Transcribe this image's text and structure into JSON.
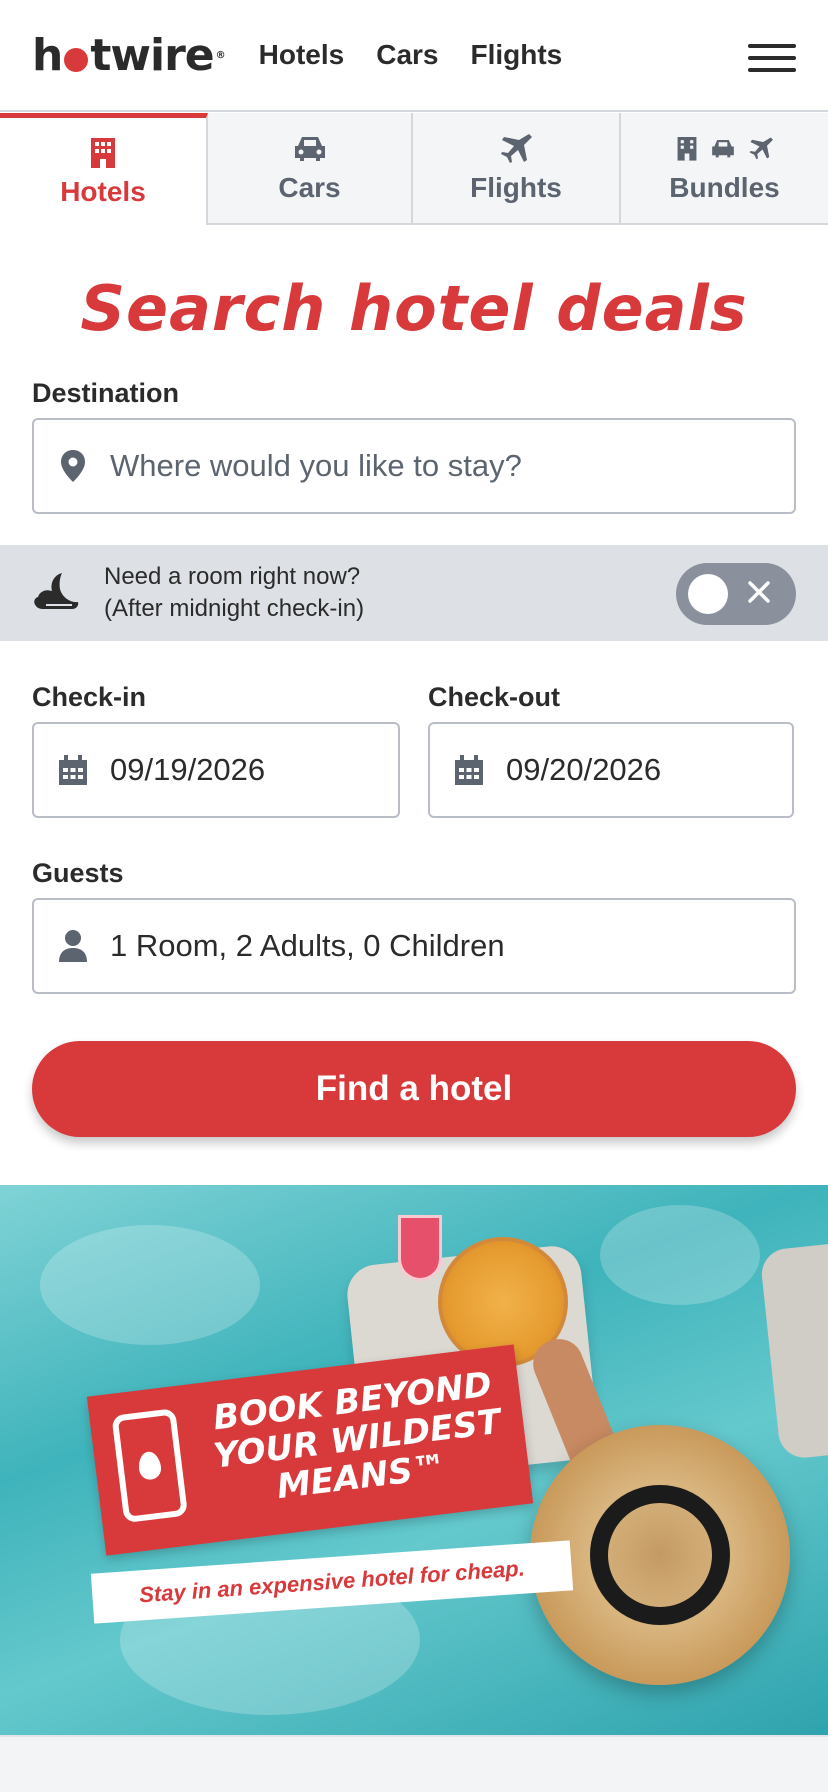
{
  "header": {
    "logo": "hotwire",
    "nav": [
      "Hotels",
      "Cars",
      "Flights"
    ]
  },
  "tabs": [
    {
      "label": "Hotels",
      "active": true
    },
    {
      "label": "Cars",
      "active": false
    },
    {
      "label": "Flights",
      "active": false
    },
    {
      "label": "Bundles",
      "active": false
    }
  ],
  "search": {
    "title": "Search hotel deals",
    "destination_label": "Destination",
    "destination_placeholder": "Where would you like to stay?",
    "midnight_line1": "Need a room right now?",
    "midnight_line2": "(After midnight check-in)",
    "checkin_label": "Check-in",
    "checkin_value": "09/19/2026",
    "checkout_label": "Check-out",
    "checkout_value": "09/20/2026",
    "guests_label": "Guests",
    "guests_value": "1 Room, 2 Adults, 0 Children",
    "cta_label": "Find a hotel"
  },
  "promo": {
    "headline_line1": "BOOK BEYOND",
    "headline_line2": "YOUR WILDEST",
    "headline_line3": "MEANS™",
    "tagline": "Stay in an expensive hotel for cheap."
  },
  "colors": {
    "brand_red": "#d8393b",
    "text_dark": "#2b2b2b",
    "muted": "#5c6470",
    "banner_bg": "#dde1e6"
  }
}
